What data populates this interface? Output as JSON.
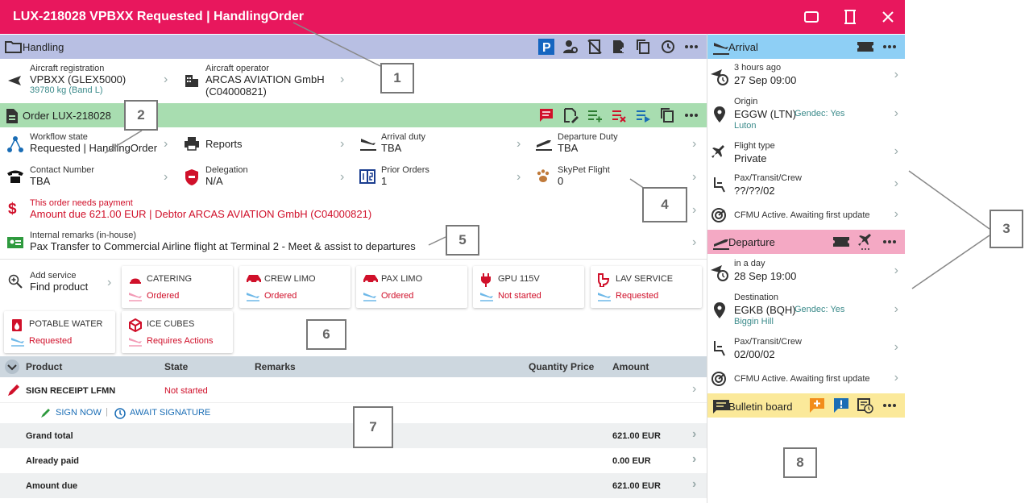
{
  "window": {
    "title": "LUX-218028 VPBXX Requested | HandlingOrder",
    "titlebar_color": "#e8175d"
  },
  "handling": {
    "header": "Handling",
    "header_color": "#b8bfe3",
    "aircraft_registration_label": "Aircraft registration",
    "aircraft_registration_value": "VPBXX (GLEX5000)",
    "aircraft_registration_sub": "39780 kg (Band L)",
    "aircraft_operator_label": "Aircraft operator",
    "aircraft_operator_value_1": "ARCAS AVIATION GmbH",
    "aircraft_operator_value_2": "(C04000821)"
  },
  "order": {
    "header": "Order LUX-218028",
    "header_color": "#a8ddb0",
    "workflow_label": "Workflow state",
    "workflow_value": "Requested | HandlingOrder",
    "reports": "Reports",
    "arrival_duty_label": "Arrival duty",
    "arrival_duty_value": "TBA",
    "departure_duty_label": "Departure Duty",
    "departure_duty_value": "TBA",
    "contact_label": "Contact Number",
    "contact_value": "TBA",
    "delegation_label": "Delegation",
    "delegation_value": "N/A",
    "prior_orders_label": "Prior Orders",
    "prior_orders_value": "1",
    "skypet_label": "SkyPet Flight",
    "skypet_value": "0",
    "payment_label": "This order needs payment",
    "payment_value": "Amount due 621.00 EUR | Debtor ARCAS AVIATION GmbH (C04000821)",
    "remarks_label": "Internal remarks (in-house)",
    "remarks_value": "Pax Transfer to Commercial Airline flight at Terminal 2 - Meet & assist to departures"
  },
  "services": {
    "add_label": "Add service",
    "find_label": "Find product",
    "items": [
      {
        "name": "CATERING",
        "status": "Ordered"
      },
      {
        "name": "CREW LIMO",
        "status": "Ordered"
      },
      {
        "name": "PAX LIMO",
        "status": "Ordered"
      },
      {
        "name": "GPU 115V",
        "status": "Not started"
      },
      {
        "name": "LAV SERVICE",
        "status": "Requested"
      },
      {
        "name": "POTABLE WATER",
        "status": "Requested"
      },
      {
        "name": "ICE CUBES",
        "status": "Requires Actions"
      }
    ]
  },
  "table": {
    "columns": [
      "Product",
      "State",
      "Remarks",
      "Quantity",
      "Price",
      "Amount"
    ],
    "row_product": "SIGN RECEIPT LFMN",
    "row_state": "Not started",
    "sign_now": "SIGN NOW",
    "separator": "|",
    "await_signature": "AWAIT SIGNATURE",
    "totals": [
      {
        "label": "Grand total",
        "value": "621.00 EUR"
      },
      {
        "label": "Already paid",
        "value": "0.00 EUR"
      },
      {
        "label": "Amount due",
        "value": "621.00 EUR"
      }
    ]
  },
  "arrival": {
    "header": "Arrival",
    "header_color": "#8ecff5",
    "time_rel": "3 hours ago",
    "time_abs": "27 Sep 09:00",
    "origin_label": "Origin",
    "origin_value": "EGGW (LTN)",
    "origin_gendec": "Gendec: Yes",
    "origin_city": "Luton",
    "flight_type_label": "Flight type",
    "flight_type_value": "Private",
    "pax_label": "Pax/Transit/Crew",
    "pax_value": "??/??/02",
    "cfmu": "CFMU Active. Awaiting first update"
  },
  "departure": {
    "header": "Departure",
    "header_color": "#f4a9c4",
    "time_rel": "in a day",
    "time_abs": "28 Sep 19:00",
    "destination_label": "Destination",
    "destination_value": "EGKB (BQH)",
    "destination_gendec": "Gendec: Yes",
    "destination_city": "Biggin Hill",
    "pax_label": "Pax/Transit/Crew",
    "pax_value": "02/00/02",
    "cfmu": "CFMU Active. Awaiting first update"
  },
  "bulletin": {
    "header": "Bulletin board",
    "header_color": "#fbe99a"
  },
  "callouts": [
    "1",
    "2",
    "3",
    "4",
    "5",
    "6",
    "7",
    "8"
  ],
  "colors": {
    "accent_red": "#d0102a",
    "teal_sub": "#3a8a8a",
    "link_blue": "#1a6db5"
  }
}
